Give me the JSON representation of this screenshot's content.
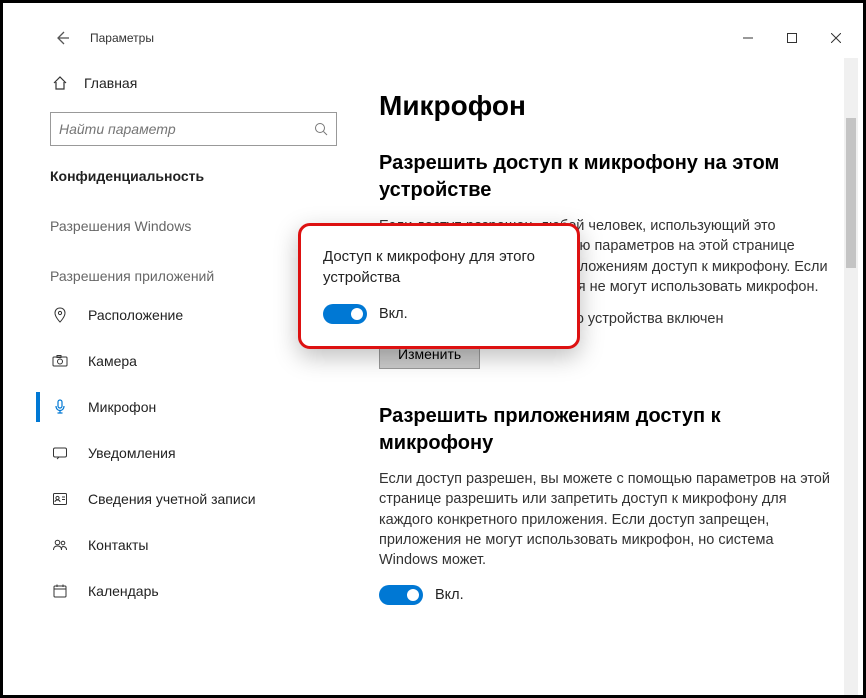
{
  "window": {
    "title": "Параметры"
  },
  "sidebar": {
    "home": "Главная",
    "search_placeholder": "Найти параметр",
    "section": "Конфиденциальность",
    "group_windows": "Разрешения Windows",
    "group_apps": "Разрешения приложений",
    "items": [
      {
        "label": "Расположение"
      },
      {
        "label": "Камера"
      },
      {
        "label": "Микрофон"
      },
      {
        "label": "Уведомления"
      },
      {
        "label": "Сведения учетной записи"
      },
      {
        "label": "Контакты"
      },
      {
        "label": "Календарь"
      }
    ]
  },
  "content": {
    "page_title": "Микрофон",
    "s1_head": "Разрешить доступ к микрофону на этом устройстве",
    "s1_body": "Если доступ разрешен, любой человек, использующий это устройство, сможет с помощью параметров на этой странице разрешить или запретить приложениям доступ к микрофону. Если доступ запрещен, приложения не могут использовать микрофон.",
    "s1_status": "Доступ к микрофону для этого устройства включен",
    "change_btn": "Изменить",
    "s2_head": "Разрешить приложениям доступ к микрофону",
    "s2_body": "Если доступ разрешен, вы можете с помощью параметров на этой странице разрешить или запретить доступ к микрофону для каждого конкретного приложения. Если доступ запрещен, приложения не могут использовать микрофон, но система Windows может.",
    "toggle_on": "Вкл."
  },
  "popover": {
    "title": "Доступ к микрофону для этого устройства",
    "toggle_label": "Вкл."
  }
}
